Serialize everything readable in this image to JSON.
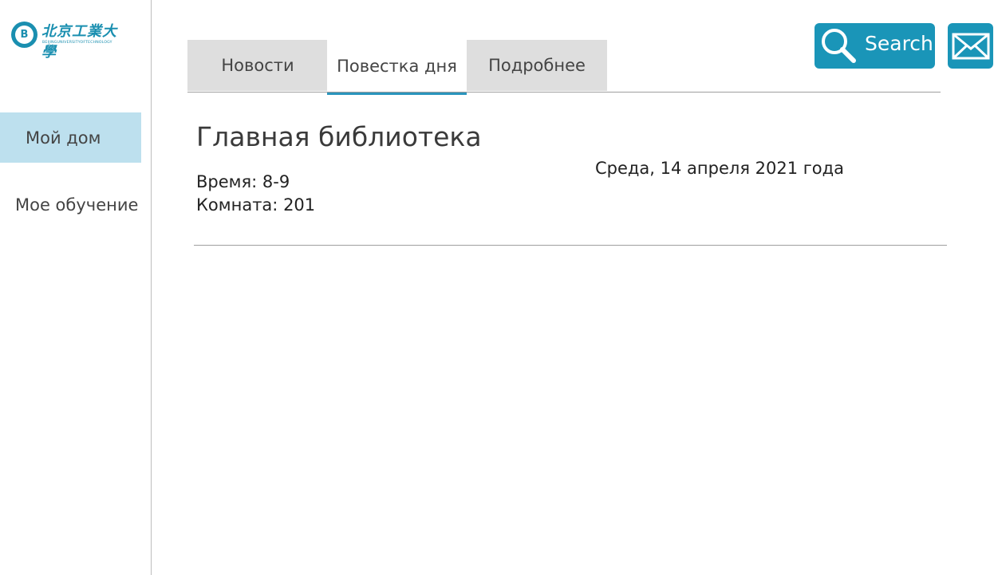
{
  "logo": {
    "mark": "B",
    "cn_text": "北京工業大學",
    "en_text": "BEIJINGUNIVERSITYOFTECHNOLOGY"
  },
  "sidebar": {
    "items": [
      {
        "label": "Мой дом",
        "active": true
      },
      {
        "label": "Мое обучение",
        "active": false
      }
    ]
  },
  "tabs": [
    {
      "label": "Новости",
      "selected": false
    },
    {
      "label": "Повестка дня",
      "selected": true
    },
    {
      "label": "Подробнее",
      "selected": false
    }
  ],
  "header": {
    "search_label": "Search",
    "search_icon": "magnifier-icon",
    "mail_icon": "envelope-icon"
  },
  "event": {
    "title": "Главная библиотека",
    "date": "Среда, 14 апреля 2021 года",
    "time_label": "Время: ",
    "time_value": "8-9",
    "room_label": "Комната: ",
    "room_value": "201"
  },
  "colors": {
    "accent": "#1a95b8",
    "active_nav_bg": "#bde0ee",
    "tab_bg": "#dedede",
    "tab_underline": "#2a95bd"
  }
}
